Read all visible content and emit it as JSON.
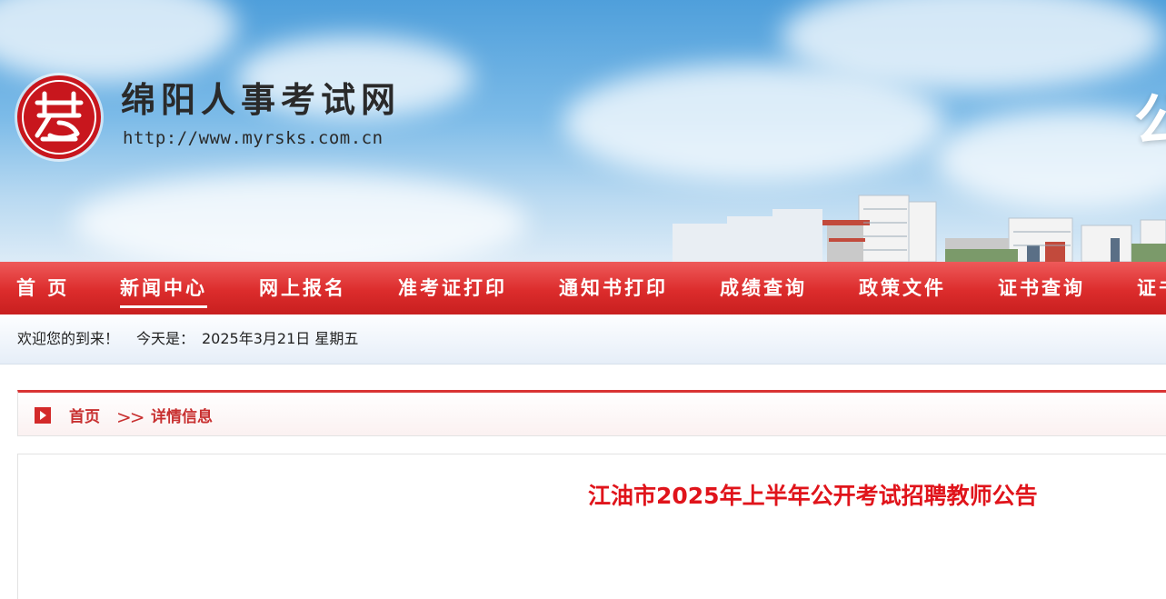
{
  "banner": {
    "site_name": "绵阳人事考试网",
    "site_url": "http://www.myrsks.com.cn",
    "right_text": "公"
  },
  "nav": {
    "items": [
      {
        "label": "首 页"
      },
      {
        "label": "新闻中心",
        "active": true
      },
      {
        "label": "网上报名"
      },
      {
        "label": "准考证打印"
      },
      {
        "label": "通知书打印"
      },
      {
        "label": "成绩查询"
      },
      {
        "label": "政策文件"
      },
      {
        "label": "证书查询"
      },
      {
        "label": "证书"
      }
    ]
  },
  "welcome": {
    "greeting": "欢迎您的到来！",
    "today_prefix": "今天是：",
    "date": "2025年3月21日 星期五"
  },
  "breadcrumb": {
    "icon": "play-icon",
    "home": "首页",
    "separator": ">>",
    "current": "详情信息"
  },
  "article": {
    "title": "江油市2025年上半年公开考试招聘教师公告"
  },
  "colors": {
    "nav_red": "#dc2c2c",
    "title_red": "#e0141b",
    "crumb_red": "#c83030"
  }
}
